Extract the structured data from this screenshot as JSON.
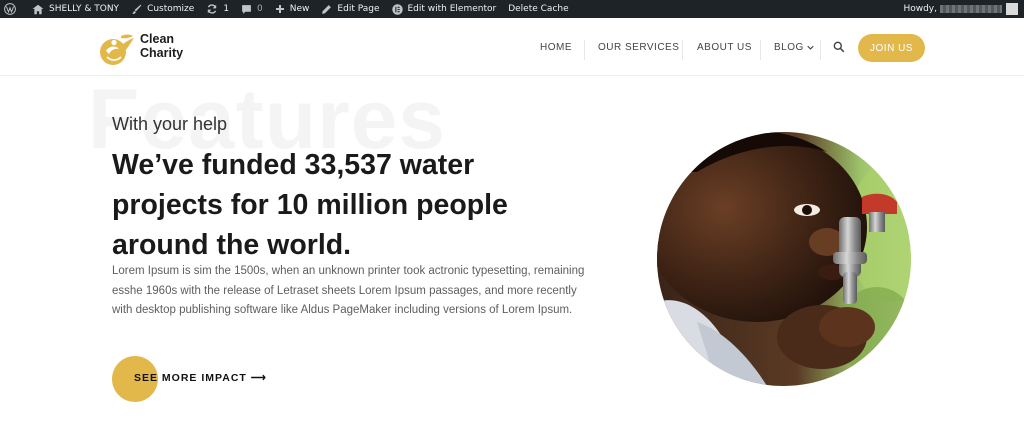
{
  "admin_bar": {
    "site_name": "SHELLY & TONY",
    "customize": "Customize",
    "updates_count": "1",
    "comments_count": "0",
    "new": "New",
    "edit_page": "Edit Page",
    "edit_elementor": "Edit with Elementor",
    "delete_cache": "Delete Cache",
    "howdy": "Howdy,"
  },
  "brand": {
    "line1": "Clean",
    "line2": "Charity"
  },
  "nav": {
    "home": "HOME",
    "services": "OUR SERVICES",
    "about": "ABOUT US",
    "blog": "BLOG",
    "join": "JOIN US"
  },
  "hero": {
    "watermark": "Features",
    "eyebrow": "With your help",
    "headline_1": "We’ve funded 33,537 water",
    "headline_2": "projects for 10 million people",
    "headline_3": "around the world.",
    "body": "Lorem Ipsum is sim the 1500s, when an unknown printer took actronic typesetting, remaining esshe 1960s with the release of Letraset sheets Lorem Ipsum passages, and more recently with desktop publishing software like Aldus PageMaker including versions of Lorem Ipsum.",
    "cta": "SEE MORE IMPACT ⟶"
  },
  "colors": {
    "accent": "#e3b84a",
    "admin_bar": "#1d2327",
    "heading": "#1a1a1a",
    "body": "#5e5e5e"
  },
  "icons": [
    "wordpress-icon",
    "home-icon",
    "brush-icon",
    "refresh-icon",
    "comment-icon",
    "plus-icon",
    "pencil-icon",
    "elementor-icon",
    "search-icon",
    "chevron-down-icon"
  ]
}
